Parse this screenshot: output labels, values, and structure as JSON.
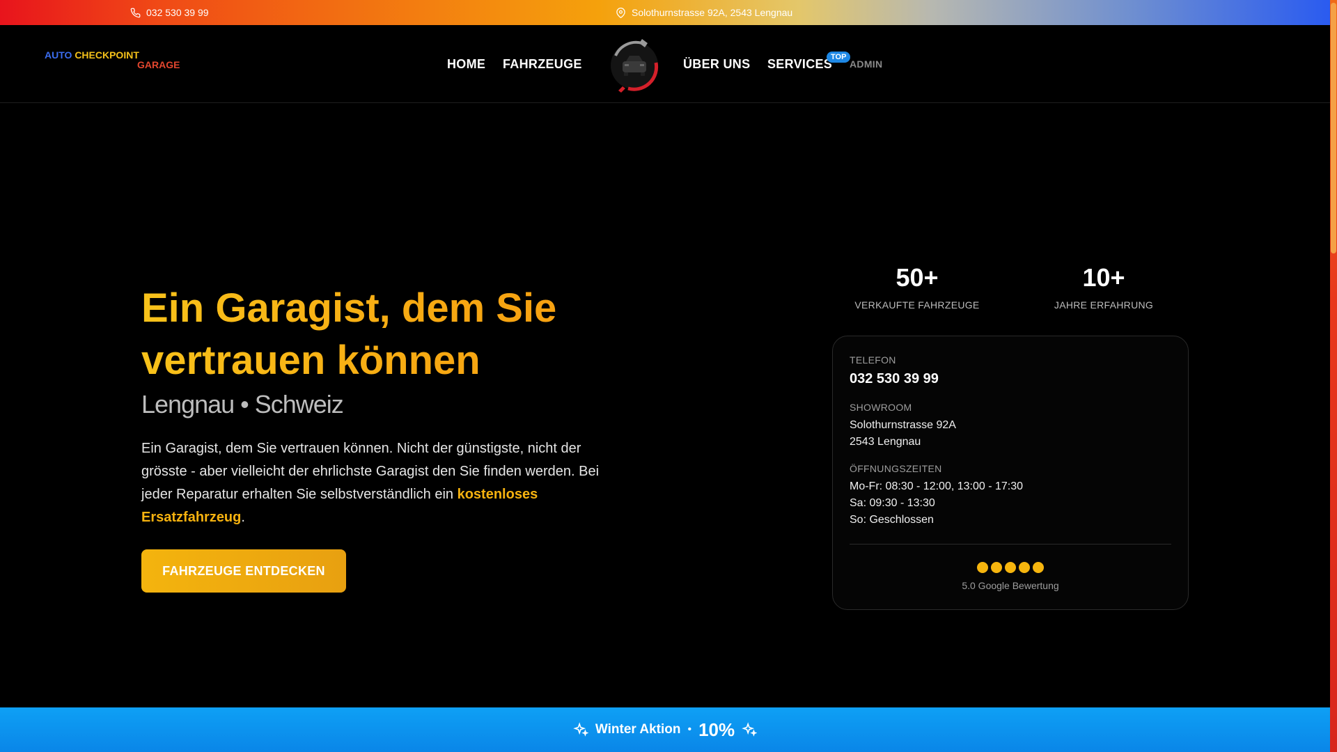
{
  "topbar": {
    "phone": "032 530 39 99",
    "address": "Solothurnstrasse 92A, 2543 Lengnau",
    "phone_icon": "phone-icon",
    "location_icon": "map-pin-icon"
  },
  "logo": {
    "part1": "AUTO",
    "part2": "CHECKPOINT",
    "part3": "GARAGE"
  },
  "nav": {
    "home": "HOME",
    "fahrzeuge": "FAHRZEUGE",
    "ueber_uns": "ÜBER UNS",
    "services": "SERVICES",
    "top_badge": "TOP",
    "admin": "ADMIN",
    "emblem_icon": "car-wrench-emblem-icon"
  },
  "hero": {
    "title": "Ein Garagist, dem Sie vertrauen können",
    "subtitle": "Lengnau • Schweiz",
    "text_part1": "Ein Garagist, dem Sie vertrauen können. Nicht der günstigste, nicht der grösste - aber vielleicht der ehrlichste Garagist den Sie finden werden. Bei jeder Reparatur erhalten Sie selbstverständlich ein ",
    "text_highlight": "kostenloses Ersatzfahrzeug",
    "text_end": ".",
    "cta": "FAHRZEUGE ENTDECKEN"
  },
  "stats": [
    {
      "value": "50+",
      "label": "VERKAUFTE FAHRZEUGE"
    },
    {
      "value": "10+",
      "label": "JAHRE ERFAHRUNG"
    }
  ],
  "card": {
    "phone_caption": "TELEFON",
    "phone": "032 530 39 99",
    "showroom_caption": "SHOWROOM",
    "showroom_line1": "Solothurnstrasse 92A",
    "showroom_line2": "2543 Lengnau",
    "hours_caption": "ÖFFNUNGSZEITEN",
    "hours_line1": "Mo-Fr: 08:30 - 12:00, 13:00 - 17:30",
    "hours_line2": "Sa: 09:30 - 13:30",
    "hours_line3": "So: Geschlossen",
    "stars": 5,
    "rating": "5.0 Google Bewertung"
  },
  "banner": {
    "title": "Winter Aktion",
    "separator": "•",
    "percent": "10%",
    "icon": "sparkle-icon"
  },
  "colors": {
    "accent": "#f6b20f",
    "badge": "#1e88e5",
    "banner": "#0a8fee"
  }
}
